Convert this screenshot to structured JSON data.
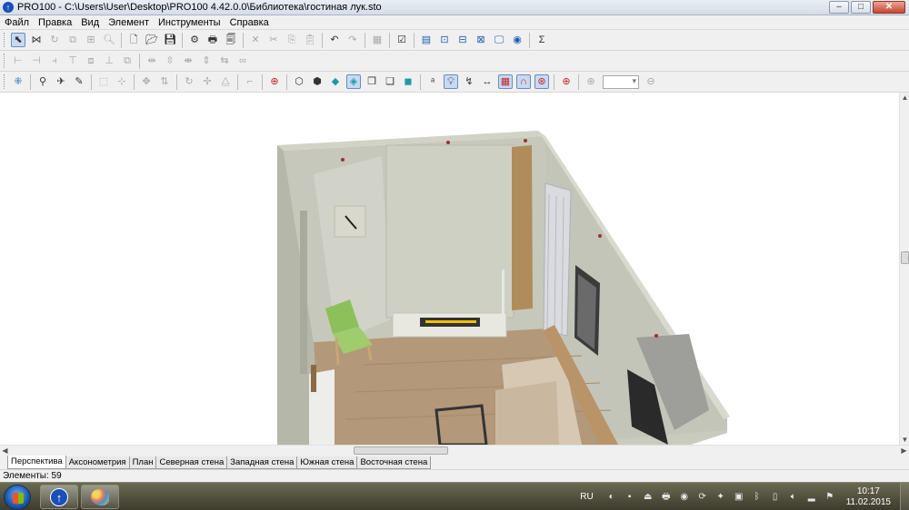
{
  "window": {
    "title": "PRO100 - C:\\Users\\User\\Desktop\\PRO100 4.42.0.0\\Библиотека\\гостиная лук.sto",
    "minimize": "–",
    "maximize": "□",
    "close": "✕"
  },
  "menu": [
    "Файл",
    "Правка",
    "Вид",
    "Элемент",
    "Инструменты",
    "Справка"
  ],
  "toolbar1": {
    "sigma_label": "Σ"
  },
  "view_tabs": [
    {
      "label": "Перспектива",
      "active": true
    },
    {
      "label": "Аксонометрия",
      "active": false
    },
    {
      "label": "План",
      "active": false
    },
    {
      "label": "Северная стена",
      "active": false
    },
    {
      "label": "Западная стена",
      "active": false
    },
    {
      "label": "Южная стена",
      "active": false
    },
    {
      "label": "Восточная стена",
      "active": false
    }
  ],
  "status": {
    "elements_label": "Элементы: 59"
  },
  "taskbar": {
    "language": "RU",
    "time": "10:17",
    "date": "11.02.2015"
  },
  "colors": {
    "wall": "#c4c6b8",
    "floor": "#b09574",
    "chair": "#8dc05a",
    "fireplace_flame": "#f5c000"
  }
}
